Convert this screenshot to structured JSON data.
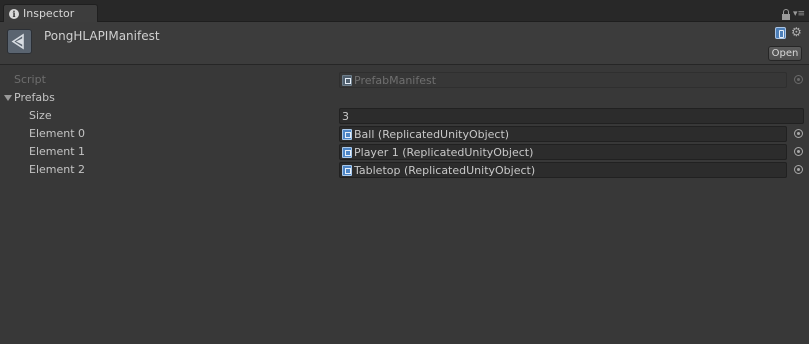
{
  "tab": {
    "title": "Inspector"
  },
  "header": {
    "asset_name": "PongHLAPIManifest",
    "open_label": "Open"
  },
  "script": {
    "label": "Script",
    "value": "PrefabManifest"
  },
  "prefabs": {
    "label": "Prefabs",
    "size_label": "Size",
    "size_value": "3",
    "elements": [
      {
        "label": "Element 0",
        "value": "Ball (ReplicatedUnityObject)"
      },
      {
        "label": "Element 1",
        "value": "Player 1 (ReplicatedUnityObject)"
      },
      {
        "label": "Element 2",
        "value": "Tabletop (ReplicatedUnityObject)"
      }
    ]
  }
}
